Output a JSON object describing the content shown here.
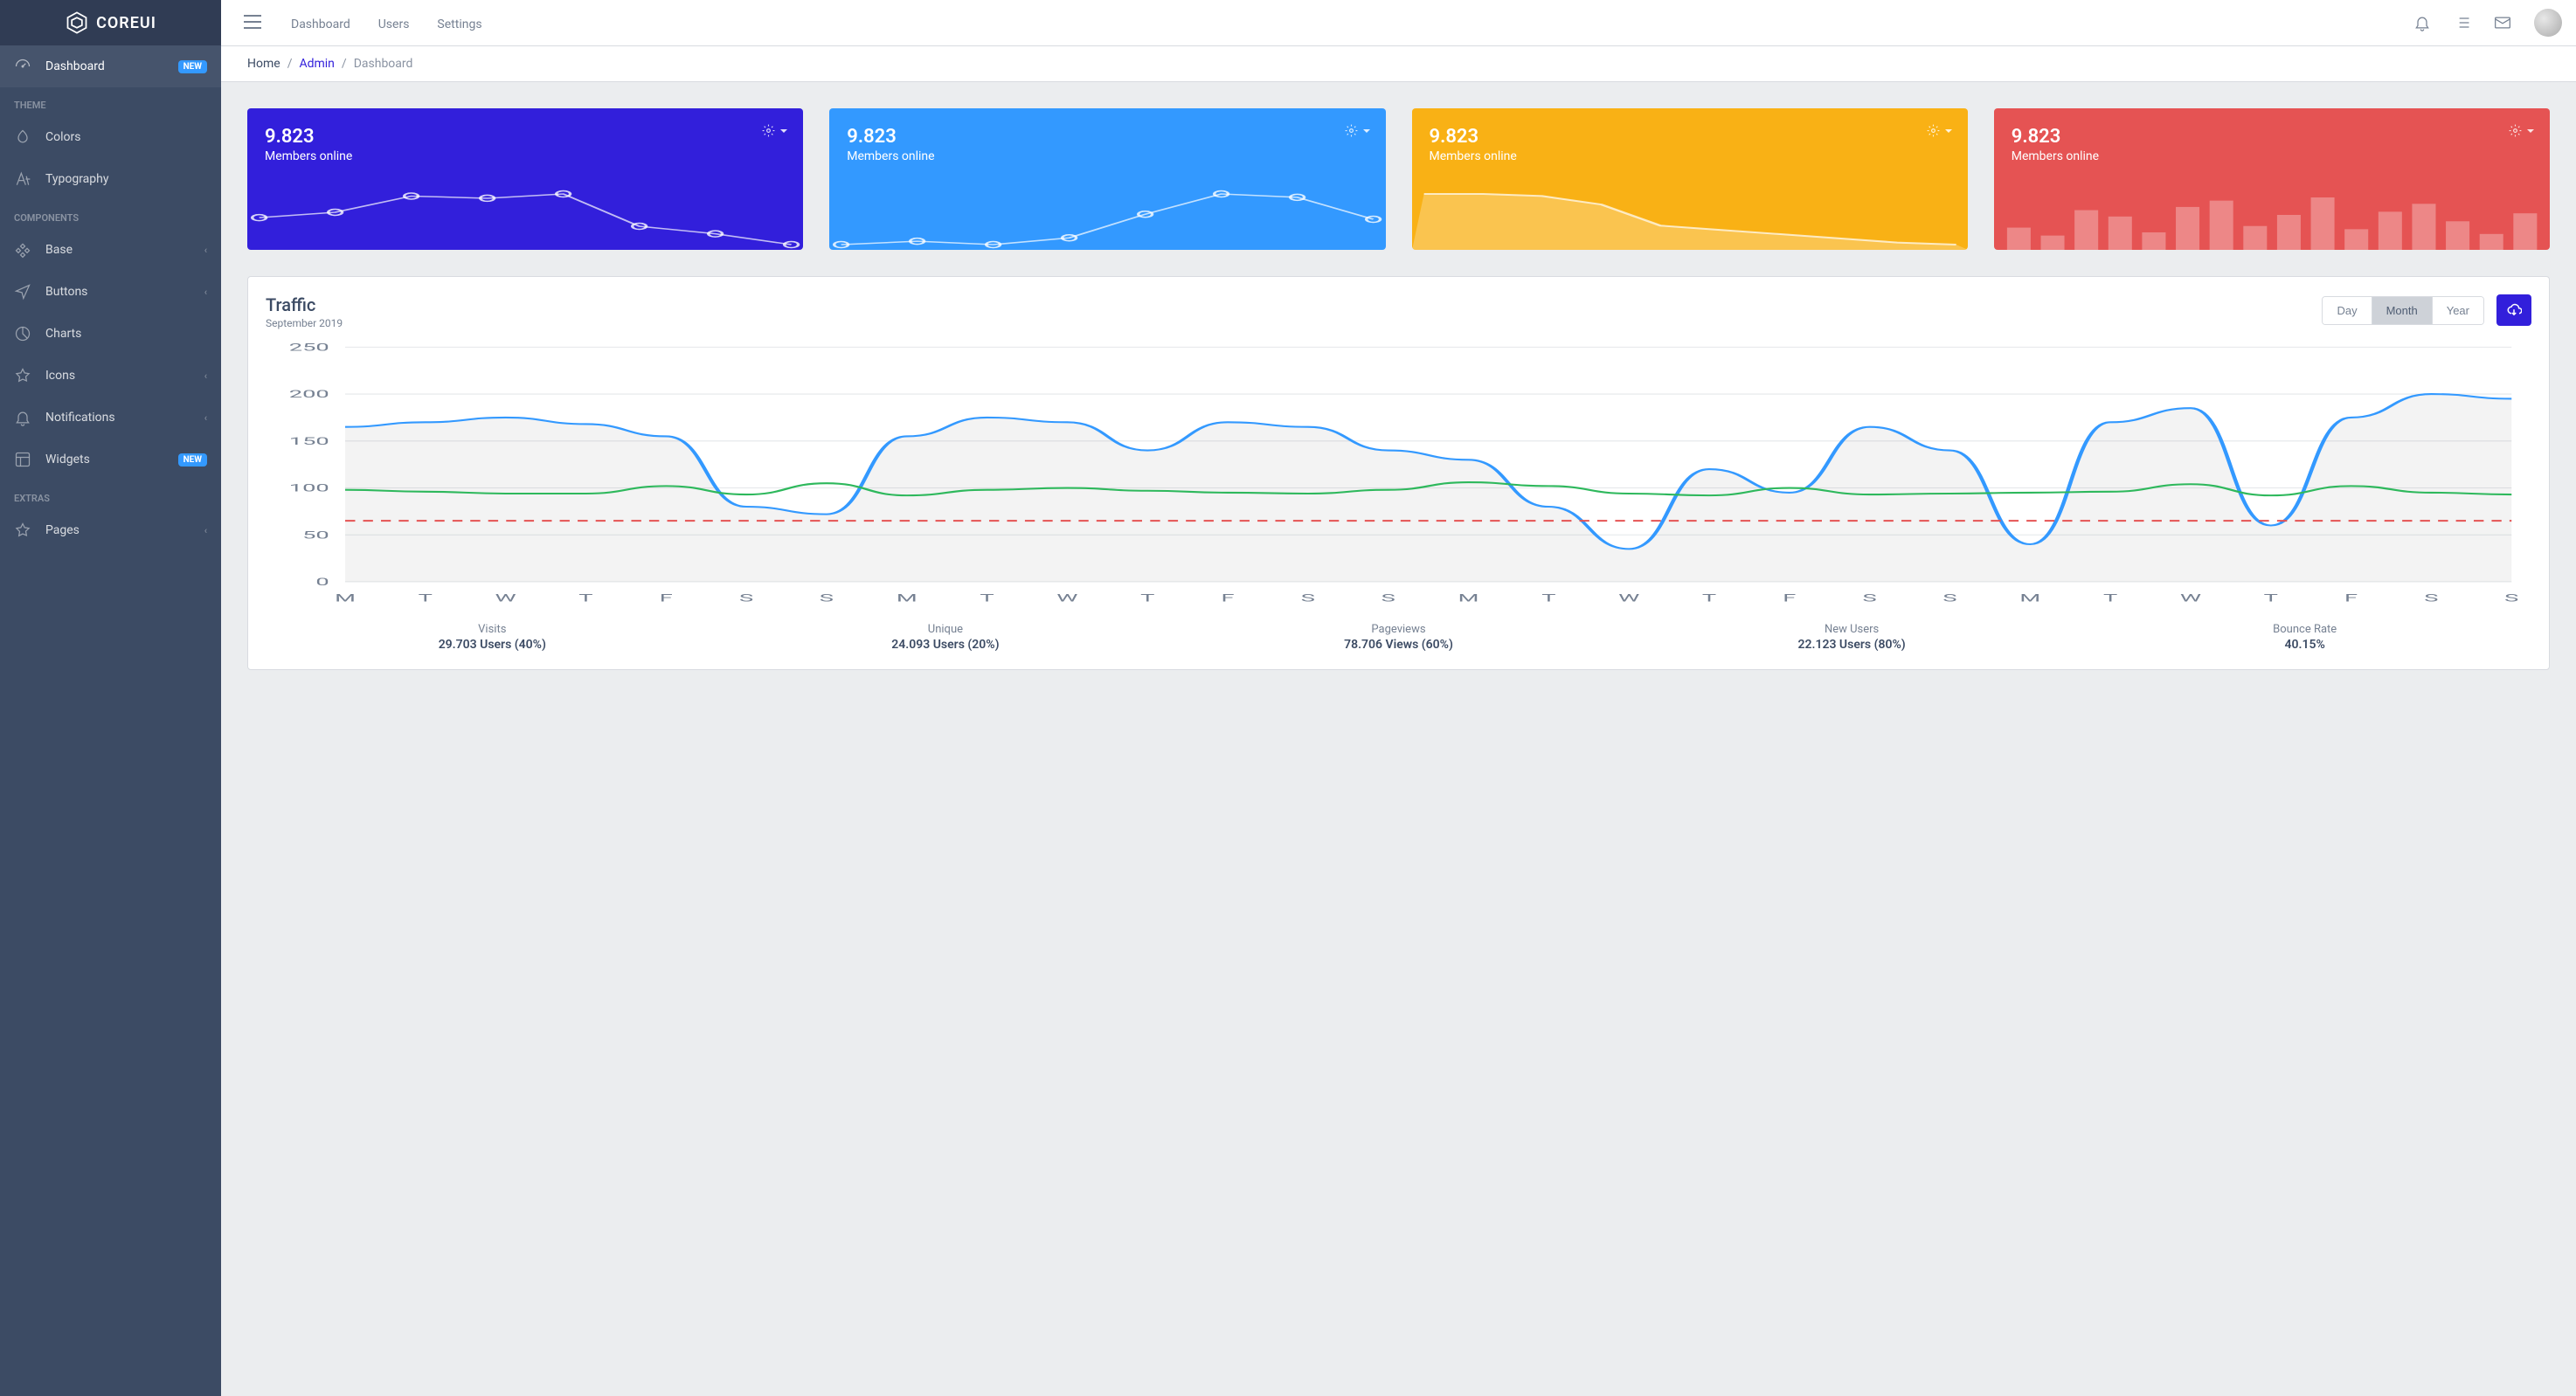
{
  "brand": "COREUI",
  "sidebar": {
    "items": [
      {
        "label": "Dashboard",
        "badge": "NEW"
      }
    ],
    "sections": [
      {
        "title": "THEME",
        "items": [
          {
            "label": "Colors"
          },
          {
            "label": "Typography"
          }
        ]
      },
      {
        "title": "COMPONENTS",
        "items": [
          {
            "label": "Base",
            "chevron": true
          },
          {
            "label": "Buttons",
            "chevron": true
          },
          {
            "label": "Charts"
          },
          {
            "label": "Icons",
            "chevron": true
          },
          {
            "label": "Notifications",
            "chevron": true
          },
          {
            "label": "Widgets",
            "badge": "NEW"
          }
        ]
      },
      {
        "title": "EXTRAS",
        "items": [
          {
            "label": "Pages",
            "chevron": true
          }
        ]
      }
    ]
  },
  "header": {
    "nav": [
      "Dashboard",
      "Users",
      "Settings"
    ]
  },
  "breadcrumb": {
    "home": "Home",
    "admin": "Admin",
    "current": "Dashboard"
  },
  "stat_cards": [
    {
      "value": "9.823",
      "label": "Members online",
      "color": "primary"
    },
    {
      "value": "9.823",
      "label": "Members online",
      "color": "info"
    },
    {
      "value": "9.823",
      "label": "Members online",
      "color": "warning"
    },
    {
      "value": "9.823",
      "label": "Members online",
      "color": "danger"
    }
  ],
  "traffic": {
    "title": "Traffic",
    "subtitle": "September 2019",
    "range_buttons": [
      "Day",
      "Month",
      "Year"
    ],
    "active_range": "Month"
  },
  "footer_stats": [
    {
      "label": "Visits",
      "value": "29.703 Users (40%)"
    },
    {
      "label": "Unique",
      "value": "24.093 Users (20%)"
    },
    {
      "label": "Pageviews",
      "value": "78.706 Views (60%)"
    },
    {
      "label": "New Users",
      "value": "22.123 Users (80%)"
    },
    {
      "label": "Bounce Rate",
      "value": "40.15%"
    }
  ],
  "chart_data": {
    "main": {
      "type": "line",
      "xlabel": "",
      "ylabel": "",
      "ylim": [
        0,
        250
      ],
      "y_ticks": [
        0,
        50,
        100,
        150,
        200,
        250
      ],
      "categories": [
        "M",
        "T",
        "W",
        "T",
        "F",
        "S",
        "S",
        "M",
        "T",
        "W",
        "T",
        "F",
        "S",
        "S",
        "M",
        "T",
        "W",
        "T",
        "F",
        "S",
        "S",
        "M",
        "T",
        "W",
        "T",
        "F",
        "S",
        "S"
      ],
      "series": [
        {
          "name": "blue",
          "color": "#39f",
          "values": [
            165,
            170,
            175,
            168,
            155,
            80,
            72,
            155,
            175,
            170,
            140,
            170,
            165,
            140,
            130,
            80,
            35,
            120,
            95,
            165,
            140,
            40,
            170,
            185,
            60,
            175,
            200,
            195
          ]
        },
        {
          "name": "green",
          "color": "#2eb85c",
          "values": [
            98,
            96,
            94,
            94,
            102,
            93,
            105,
            92,
            98,
            100,
            97,
            95,
            94,
            98,
            106,
            102,
            94,
            92,
            100,
            93,
            94,
            95,
            96,
            104,
            92,
            102,
            95,
            93
          ]
        },
        {
          "name": "red",
          "color": "#e55353",
          "dashed": true,
          "values": [
            65,
            65,
            65,
            65,
            65,
            65,
            65,
            65,
            65,
            65,
            65,
            65,
            65,
            65,
            65,
            65,
            65,
            65,
            65,
            65,
            65,
            65,
            65,
            65,
            65,
            65,
            65,
            65
          ]
        }
      ]
    },
    "mini": [
      {
        "type": "line",
        "values": [
          50,
          55,
          70,
          68,
          72,
          42,
          35,
          25
        ]
      },
      {
        "type": "line",
        "values": [
          30,
          32,
          30,
          34,
          48,
          60,
          58,
          45
        ]
      },
      {
        "type": "area",
        "values": [
          70,
          70,
          68,
          60,
          40,
          36,
          32,
          28,
          24,
          22
        ]
      },
      {
        "type": "bar",
        "values": [
          28,
          18,
          50,
          42,
          22,
          54,
          62,
          30,
          44,
          66,
          26,
          48,
          58,
          36,
          20,
          46
        ]
      }
    ]
  }
}
